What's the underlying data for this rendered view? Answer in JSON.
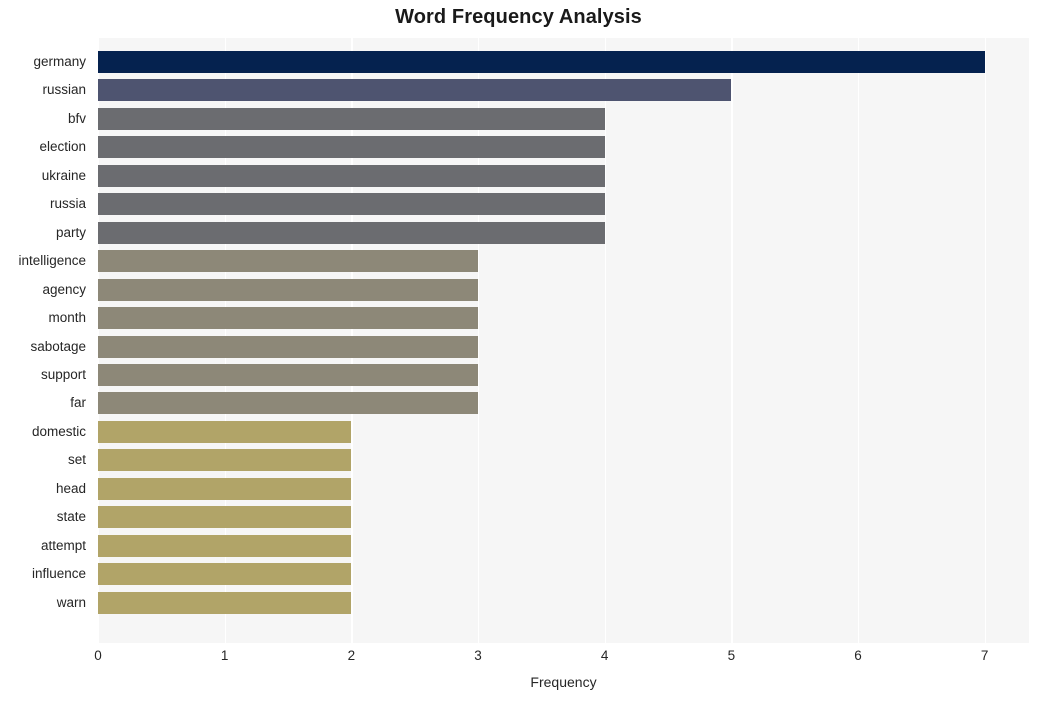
{
  "chart_data": {
    "type": "bar",
    "orientation": "horizontal",
    "title": "Word Frequency Analysis",
    "xlabel": "Frequency",
    "ylabel": "",
    "xlim": [
      0,
      7.35
    ],
    "xticks": [
      0,
      1,
      2,
      3,
      4,
      5,
      6,
      7
    ],
    "xtick_labels": [
      "0",
      "1",
      "2",
      "3",
      "4",
      "5",
      "6",
      "7"
    ],
    "grid": true,
    "grid_axis": "x",
    "grid_color": "#ffffff",
    "plot_background": "#f6f6f6",
    "figure_background": "#ffffff",
    "legend": null,
    "categories": [
      "germany",
      "russian",
      "bfv",
      "election",
      "ukraine",
      "russia",
      "party",
      "intelligence",
      "agency",
      "month",
      "sabotage",
      "support",
      "far",
      "domestic",
      "set",
      "head",
      "state",
      "attempt",
      "influence",
      "warn"
    ],
    "values": [
      7,
      5,
      4,
      4,
      4,
      4,
      4,
      3,
      3,
      3,
      3,
      3,
      3,
      2,
      2,
      2,
      2,
      2,
      2,
      2
    ],
    "bar_colors": [
      "#05224f",
      "#4e5470",
      "#6b6c70",
      "#6b6c70",
      "#6b6c70",
      "#6b6c70",
      "#6b6c70",
      "#8d8878",
      "#8d8878",
      "#8d8878",
      "#8d8878",
      "#8d8878",
      "#8d8878",
      "#b1a468",
      "#b1a468",
      "#b1a468",
      "#b1a468",
      "#b1a468",
      "#b1a468",
      "#b1a468"
    ]
  }
}
